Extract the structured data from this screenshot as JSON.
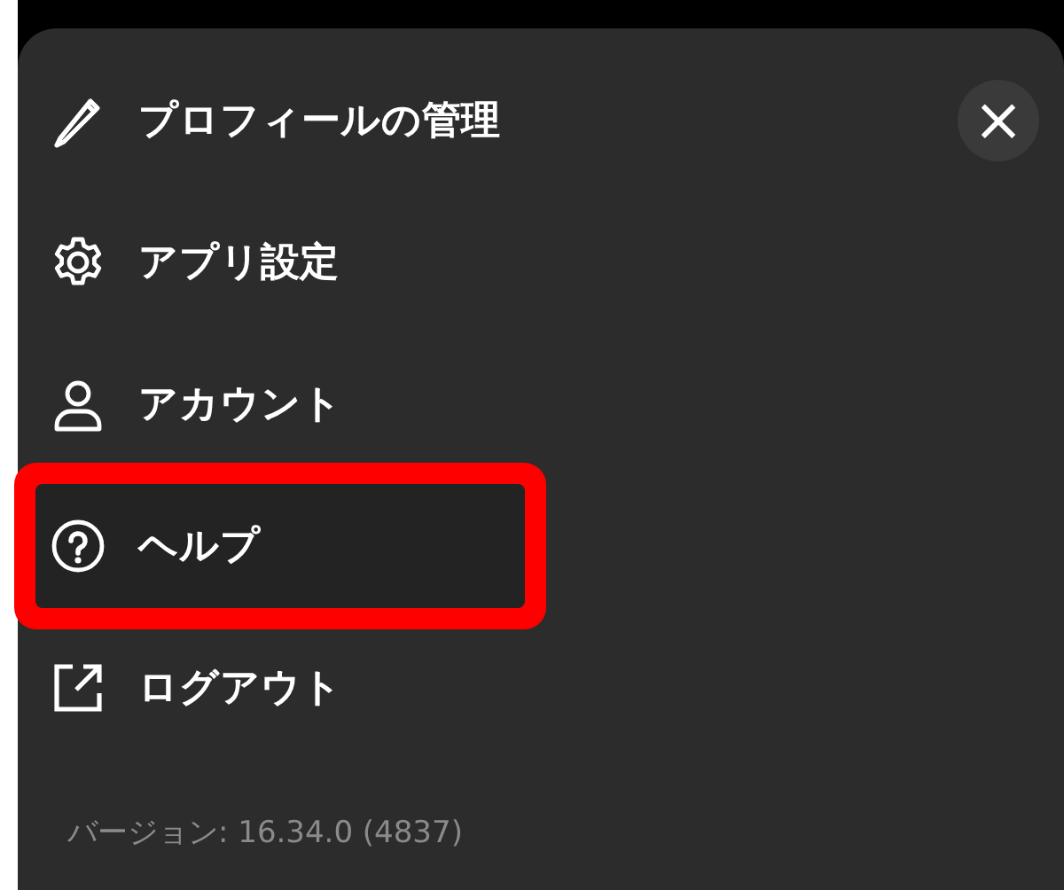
{
  "menu": {
    "items": [
      {
        "kind": "pencil",
        "label": "プロフィールの管理",
        "highlighted": false
      },
      {
        "kind": "gear",
        "label": "アプリ設定",
        "highlighted": false
      },
      {
        "kind": "person",
        "label": "アカウント",
        "highlighted": false
      },
      {
        "kind": "question",
        "label": "ヘルプ",
        "highlighted": true
      },
      {
        "kind": "export",
        "label": "ログアウト",
        "highlighted": false
      }
    ],
    "close_button": "×",
    "version": "バージョン: 16.34.0 (4837)"
  }
}
